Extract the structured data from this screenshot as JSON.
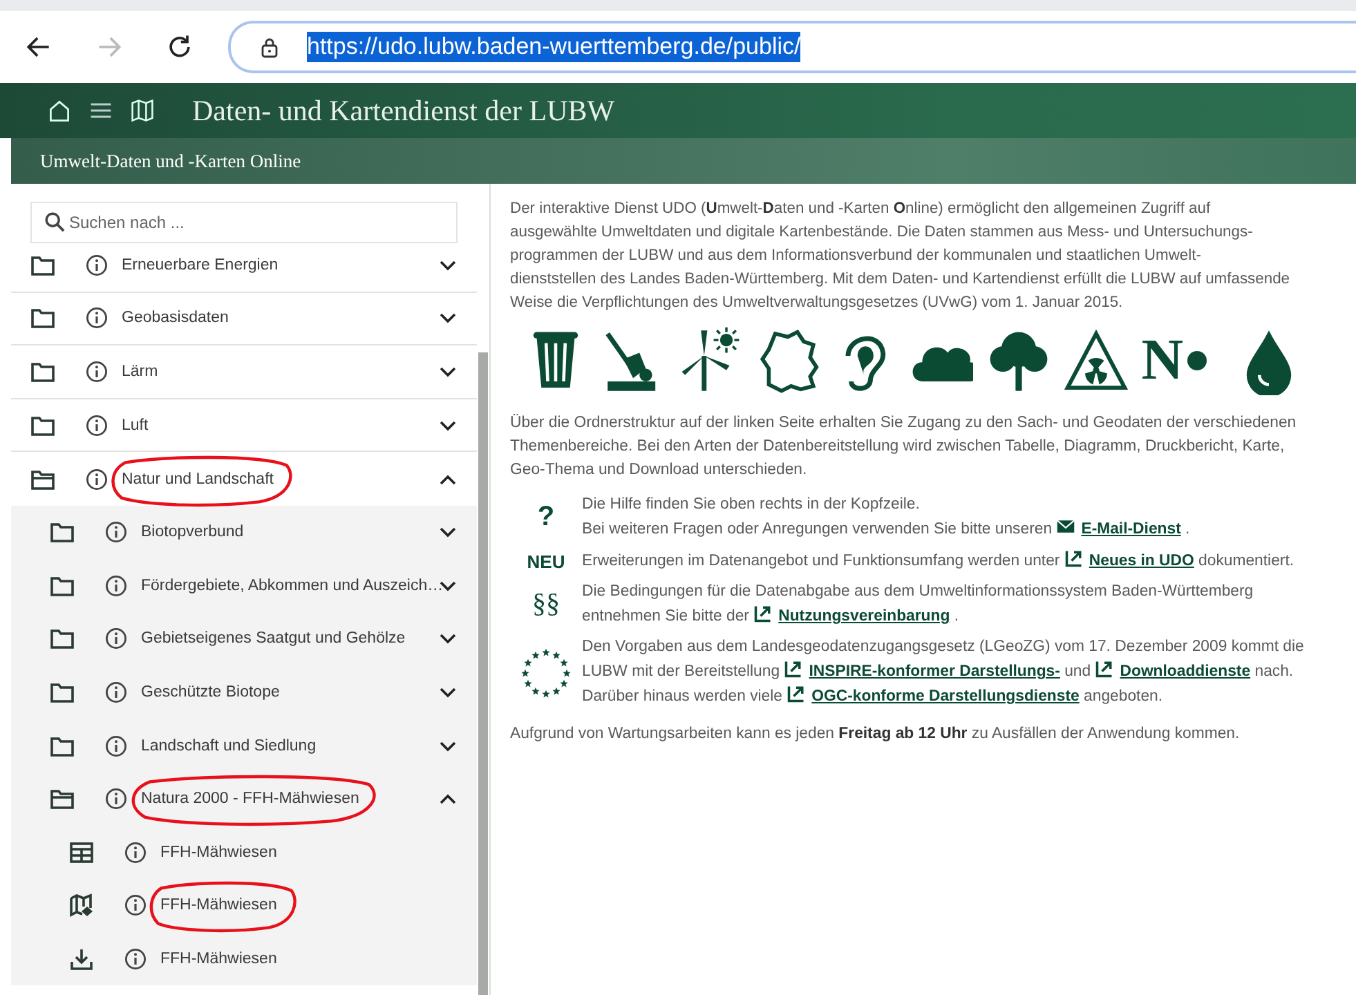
{
  "browser": {
    "url": "https://udo.lubw.baden-wuerttemberg.de/public/",
    "url_selected": true,
    "forward_disabled": true
  },
  "header": {
    "title": "Daten- und Kartendienst der LUBW",
    "subtitle": "Umwelt-Daten und -Karten Online"
  },
  "search": {
    "placeholder": "Suchen nach ..."
  },
  "tree": [
    {
      "kind": "folder",
      "label": "Erneuerbare Energien",
      "expanded": false,
      "annotated": false
    },
    {
      "kind": "folder",
      "label": "Geobasisdaten",
      "expanded": false,
      "annotated": false
    },
    {
      "kind": "folder",
      "label": "Lärm",
      "expanded": false,
      "annotated": false
    },
    {
      "kind": "folder",
      "label": "Luft",
      "expanded": false,
      "annotated": false
    },
    {
      "kind": "folder",
      "label": "Natur und Landschaft",
      "expanded": true,
      "annotated": true,
      "children": [
        {
          "kind": "folder",
          "label": "Biotopverbund",
          "expanded": false,
          "annotated": false
        },
        {
          "kind": "folder",
          "label": "Fördergebiete, Abkommen und Auszeich…",
          "expanded": false,
          "annotated": false
        },
        {
          "kind": "folder",
          "label": "Gebietseigenes Saatgut und Gehölze",
          "expanded": false,
          "annotated": false
        },
        {
          "kind": "folder",
          "label": "Geschützte Biotope",
          "expanded": false,
          "annotated": false
        },
        {
          "kind": "folder",
          "label": "Landschaft und Siedlung",
          "expanded": false,
          "annotated": false
        },
        {
          "kind": "folder",
          "label": "Natura 2000 - FFH-Mähwiesen",
          "expanded": true,
          "annotated": true,
          "children": [
            {
              "kind": "table",
              "label": "FFH-Mähwiesen",
              "annotated": false
            },
            {
              "kind": "map",
              "label": "FFH-Mähwiesen",
              "annotated": true
            },
            {
              "kind": "download",
              "label": "FFH-Mähwiesen",
              "annotated": false
            }
          ]
        }
      ]
    }
  ],
  "intro": "Der interaktive Dienst UDO (**U**mwelt-**D**aten und -Karten **O**nline) ermöglicht den allgemeinen Zugriff auf\nausgewählte Umweltdaten und digitale Kartenbestände. Die Daten stammen aus Mess- und Untersuchungs-\nprogrammen der LUBW und aus dem Informationsverbund der kommunalen und staatlichen Umwelt-\ndienststellen des Landes Baden-Württemberg. Mit dem Daten- und Kartendienst erfüllt die LUBW auf umfassende\nWeise die Verpflichtungen des Umweltverwaltungsgesetzes (UVwG) vom 1. Januar 2015.",
  "themes": [
    {
      "kind": "bin"
    },
    {
      "kind": "spade"
    },
    {
      "kind": "wind"
    },
    {
      "kind": "region"
    },
    {
      "kind": "ear"
    },
    {
      "kind": "cloud"
    },
    {
      "kind": "tree"
    },
    {
      "kind": "radiation"
    },
    {
      "kind": "letter",
      "text": "N"
    },
    {
      "kind": "drop"
    }
  ],
  "overview": "Über die Ordnerstruktur auf der linken Seite erhalten Sie Zugang zu den Sach- und Geodaten der verschiedenen Themenbereiche. Bei den Arten der Datenbereitstellung wird zwischen Tabelle, Diagramm, Druckbericht, Karte, Geo-Thema und Download unterschieden.",
  "info": [
    {
      "kind": "text",
      "symbol": "?",
      "lines": [
        [
          {
            "kind": "text",
            "text": "Die Hilfe finden Sie oben rechts in der Kopfzeile."
          }
        ],
        [
          {
            "kind": "text",
            "text": "Bei weiteren Fragen oder Anregungen verwenden Sie bitte unseren"
          },
          {
            "kind": "mail",
            "text": "E-Mail-Dienst"
          },
          {
            "kind": "text",
            "text": "."
          }
        ]
      ]
    },
    {
      "kind": "text",
      "symbol": "NEU",
      "lines": [
        [
          {
            "kind": "text",
            "text": "Erweiterungen im Datenangebot und Funktionsumfang werden unter"
          },
          {
            "kind": "link",
            "text": "Neues in UDO"
          },
          {
            "kind": "text",
            "text": "dokumentiert."
          }
        ]
      ]
    },
    {
      "kind": "text",
      "symbol": "§§",
      "lines": [
        [
          {
            "kind": "text",
            "text": "Die Bedingungen für die Datenabgabe aus dem Umweltinformationssystem Baden-Württemberg"
          }
        ],
        [
          {
            "kind": "text",
            "text": "entnehmen Sie bitte der"
          },
          {
            "kind": "link",
            "text": "Nutzungsvereinbarung"
          },
          {
            "kind": "text",
            "text": "."
          }
        ]
      ]
    },
    {
      "kind": "stars",
      "lines": [
        [
          {
            "kind": "text",
            "text": "Den Vorgaben aus dem Landesgeodatenzugangsgesetz (LGeoZG) vom 17. Dezember 2009 kommt die"
          }
        ],
        [
          {
            "kind": "text",
            "text": "LUBW mit der Bereitstellung"
          },
          {
            "kind": "link",
            "text": "INSPIRE-konformer Darstellungs-"
          },
          {
            "kind": "text",
            "text": "und"
          },
          {
            "kind": "link",
            "text": "Downloaddienste"
          },
          {
            "kind": "text",
            "text": "nach."
          }
        ],
        [
          {
            "kind": "text",
            "text": "Darüber hinaus werden viele"
          },
          {
            "kind": "link",
            "text": "OGC-konforme Darstellungsdienste"
          },
          {
            "kind": "text",
            "text": "angeboten."
          }
        ]
      ]
    }
  ],
  "notice": "Aufgrund von Wartungsarbeiten kann es jeden **Freitag ab 12 Uhr** zu Ausfällen der Anwendung kommen."
}
